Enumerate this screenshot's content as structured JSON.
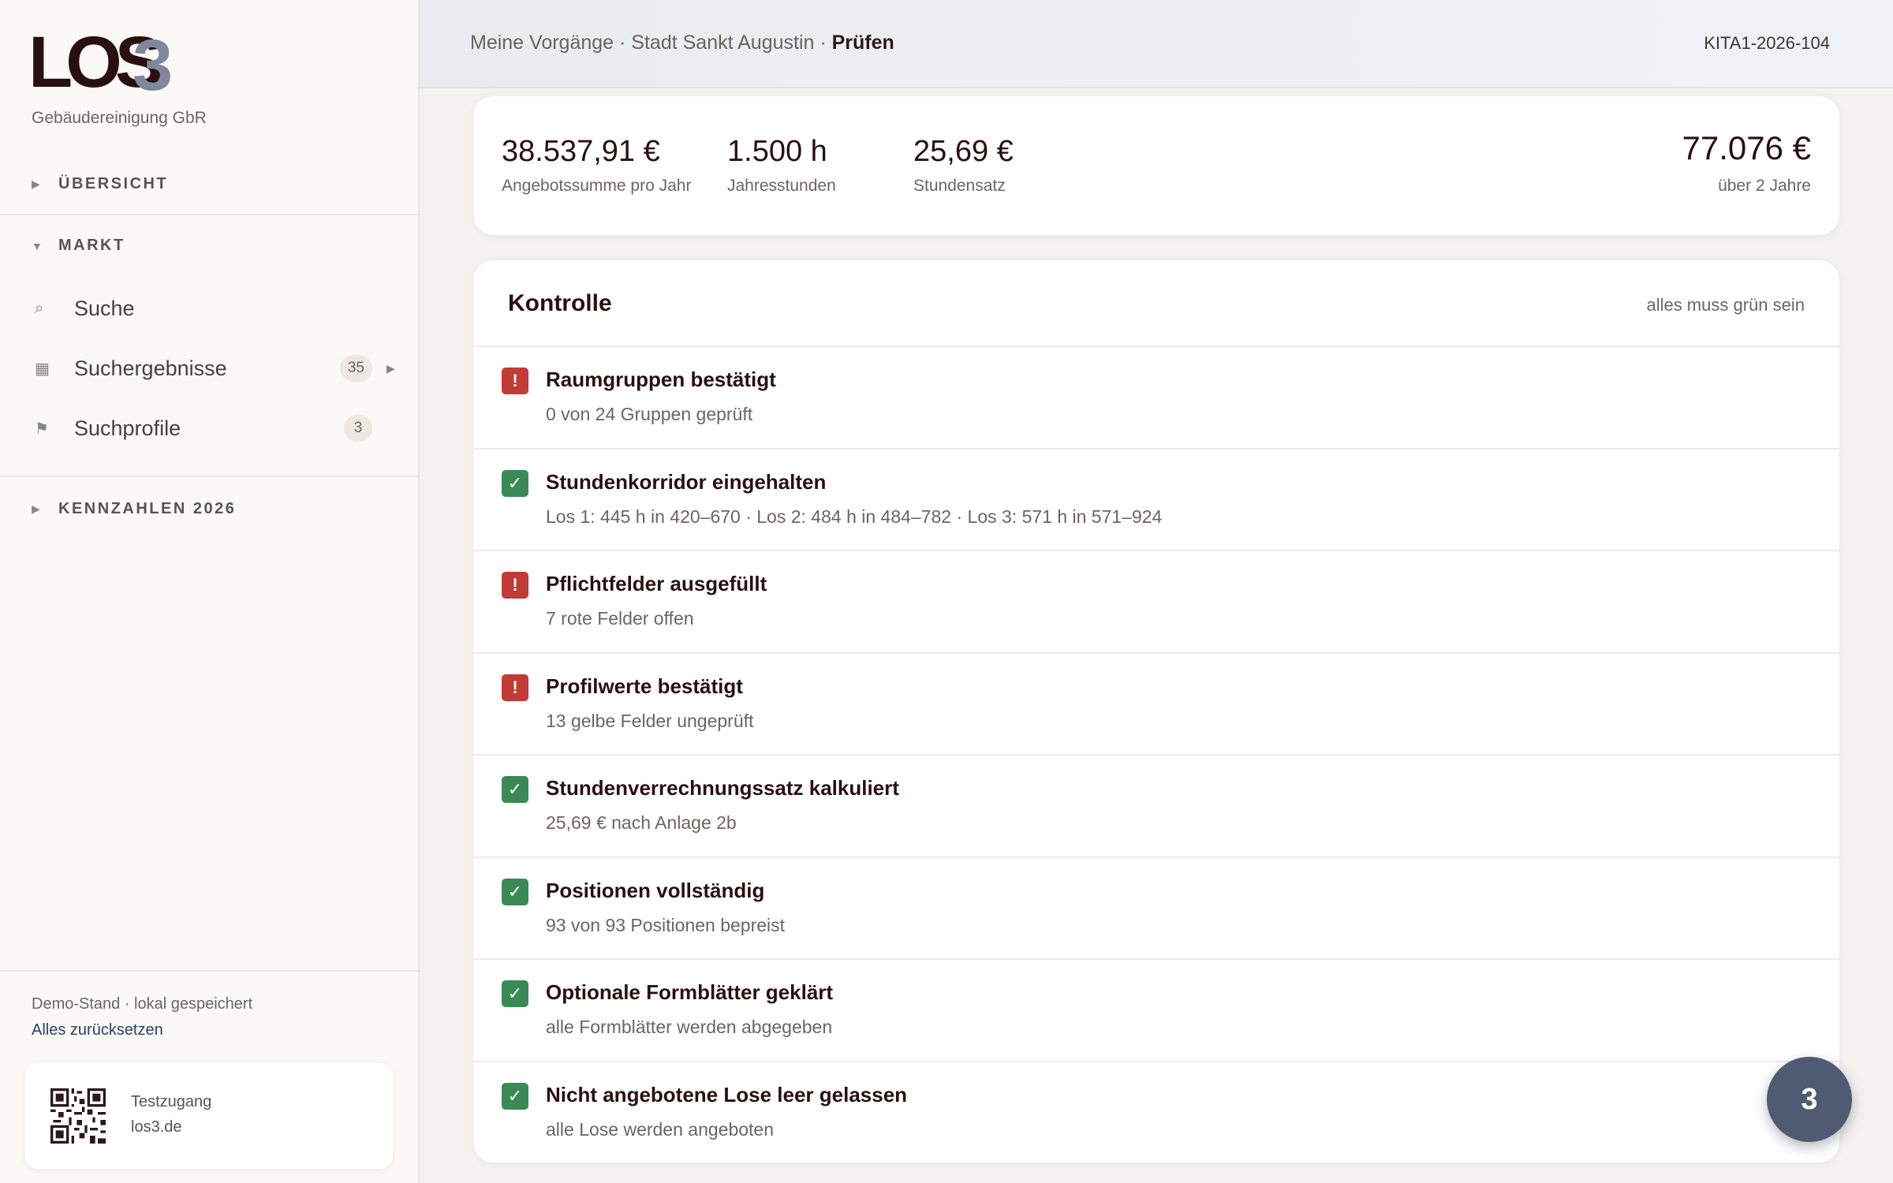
{
  "brand": {
    "logo_main": "LOS",
    "logo_accent": "3",
    "company": "Gebäudereinigung GbR",
    "logo_colors": {
      "main": "#2a0f10",
      "accent": "#7f879c"
    }
  },
  "sidebar": {
    "sections": {
      "overview": {
        "label": "ÜBERSICHT",
        "expanded": false
      },
      "market": {
        "label": "MARKT",
        "expanded": true
      },
      "kpi": {
        "label": "KENNZAHLEN 2026",
        "expanded": false
      }
    },
    "market_items": [
      {
        "label": "Suche",
        "icon": "search-icon"
      },
      {
        "label": "Suchergebnisse",
        "icon": "grid-icon",
        "badge": "35"
      },
      {
        "label": "Suchprofile",
        "icon": "flag-icon",
        "badge": "3"
      }
    ],
    "footer": {
      "status": "Demo-Stand · lokal gespeichert",
      "reset_label": "Alles zurücksetzen",
      "qr_label": "Testzugang",
      "qr_url_text": "los3.de"
    }
  },
  "header": {
    "breadcrumb_prefix": "Meine Vorgänge · Stadt Sankt Augustin · ",
    "breadcrumb_current": "Prüfen",
    "ticket_id": "KITA1-2026-104"
  },
  "stats": [
    {
      "value": "38.537,91 €",
      "label": "Angebotssumme pro Jahr"
    },
    {
      "value": "1.500 h",
      "label": "Jahresstunden"
    },
    {
      "value": "25,69 €",
      "label": "Stundensatz"
    }
  ],
  "total": {
    "value": "77.076 €",
    "label": "über 2 Jahre"
  },
  "checks": {
    "title": "Kontrolle",
    "hint": "alles muss grün sein",
    "items": [
      {
        "status": "error",
        "title": "Raumgruppen bestätigt",
        "detail": "0 von 24 Gruppen geprüft"
      },
      {
        "status": "ok",
        "title": "Stundenkorridor eingehalten",
        "detail": "Los 1: 445 h in 420–670 · Los 2: 484 h in 484–782 · Los 3: 571 h in 571–924"
      },
      {
        "status": "error",
        "title": "Pflichtfelder ausgefüllt",
        "detail": "7 rote Felder offen"
      },
      {
        "status": "error",
        "title": "Profilwerte bestätigt",
        "detail": "13 gelbe Felder ungeprüft"
      },
      {
        "status": "ok",
        "title": "Stundenverrechnungssatz kalkuliert",
        "detail": "25,69 € nach Anlage 2b"
      },
      {
        "status": "ok",
        "title": "Positionen vollständig",
        "detail": "93 von 93 Positionen bepreist"
      },
      {
        "status": "ok",
        "title": "Optionale Formblätter geklärt",
        "detail": "alle Formblätter werden abgegeben"
      },
      {
        "status": "ok",
        "title": "Nicht angebotene Lose leer gelassen",
        "detail": "alle Lose werden angeboten"
      }
    ],
    "status_icons": {
      "ok": "✓",
      "error": "!"
    },
    "status_colors": {
      "ok": "#3a8a57",
      "error": "#c23b36"
    }
  },
  "fab": {
    "label": "3"
  }
}
